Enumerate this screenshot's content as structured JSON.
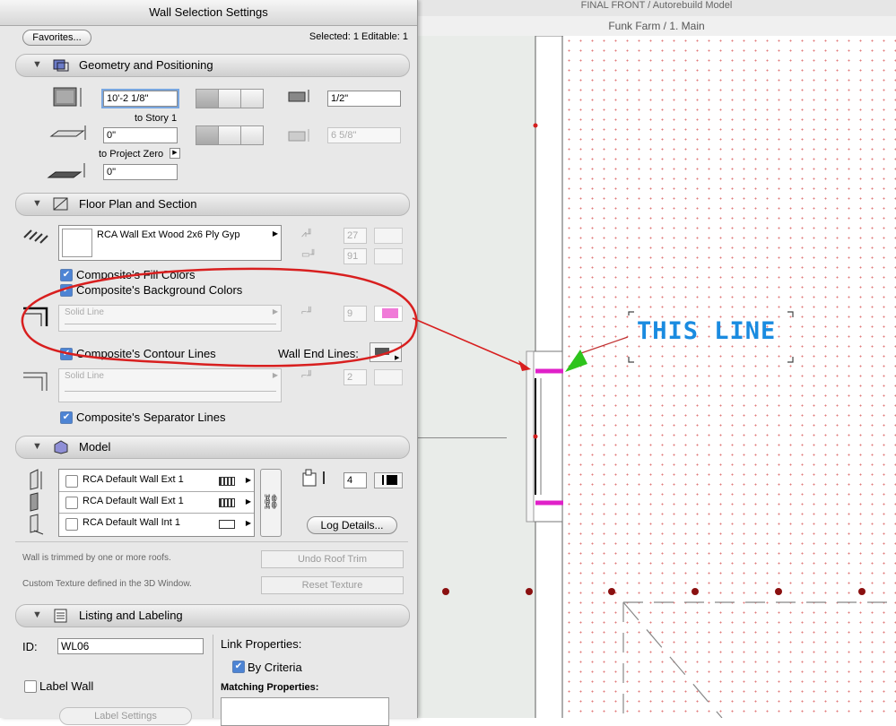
{
  "window": {
    "background_title": "FINAL FRONT / Autorebuild Model",
    "background_subtitle": "Funk Farm / 1. Main",
    "dialog_title": "Wall Selection Settings"
  },
  "header": {
    "favorites_label": "Favorites...",
    "selection_status": "Selected: 1 Editable: 1"
  },
  "geometry": {
    "title": "Geometry and Positioning",
    "height_value": "10'-2 1/8\"",
    "to_story_label": "to Story 1",
    "base_offset_value": "0\"",
    "to_project_zero_label": "to Project Zero",
    "project_zero_value": "0\"",
    "thickness_value": "1/2\"",
    "offset_value": "6 5/8\""
  },
  "floor_plan": {
    "title": "Floor Plan and Section",
    "composite_name": "RCA Wall Ext Wood 2x6 Ply Gyp",
    "pen_a": "27",
    "pen_b": "91",
    "fill_colors_label": "Composite's Fill Colors",
    "background_colors_label": "Composite's Background Colors",
    "contour_line_type": "Solid Line",
    "contour_pen": "9",
    "contour_lines_label": "Composite's Contour Lines",
    "wall_end_lines_label": "Wall End Lines:",
    "separator_line_type": "Solid Line",
    "separator_pen": "2",
    "separator_lines_label": "Composite's Separator Lines"
  },
  "model": {
    "title": "Model",
    "materials": [
      "RCA Default Wall Ext 1",
      "RCA Default Wall Ext 1",
      "RCA Default Wall Int 1"
    ],
    "pen_value": "4",
    "log_details_label": "Log Details...",
    "trim_note": "Wall is trimmed by one or more roofs.",
    "undo_roof_trim_label": "Undo Roof Trim",
    "texture_note": "Custom Texture defined in the 3D Window.",
    "reset_texture_label": "Reset Texture"
  },
  "listing": {
    "title": "Listing and Labeling",
    "id_label": "ID:",
    "id_value": "WL06",
    "link_properties_label": "Link Properties:",
    "by_criteria_label": "By Criteria",
    "label_wall_label": "Label Wall",
    "matching_properties_label": "Matching Properties:",
    "label_settings_label": "Label Settings"
  },
  "annotation": {
    "callout_text": "THIS LINE"
  },
  "colors": {
    "highlight_pink": "#e020c8",
    "red_circle": "#d81f1f",
    "callout_blue": "#1a8be0",
    "arrow_green": "#2ec41c"
  }
}
